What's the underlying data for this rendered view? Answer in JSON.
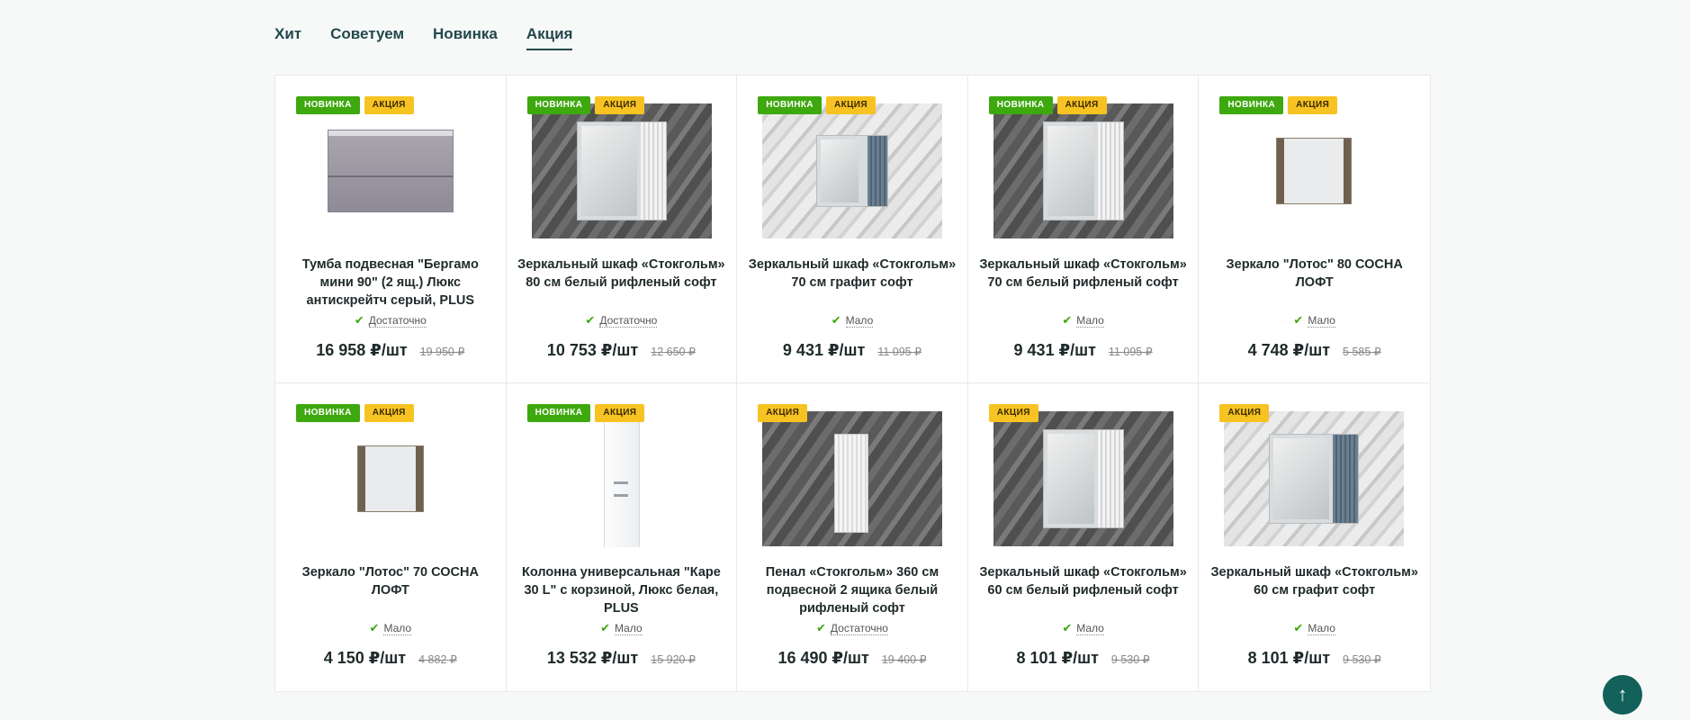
{
  "tabs": [
    {
      "label": "Хит"
    },
    {
      "label": "Советуем"
    },
    {
      "label": "Новинка"
    },
    {
      "label": "Акция"
    }
  ],
  "badge_labels": {
    "new": "НОВИНКА",
    "sale": "АКЦИЯ"
  },
  "products": [
    {
      "name": "Тумба подвесная \"Бергамо мини 90\" (2 ящ.) Люкс антискрейтч серый, PLUS",
      "stock": "Достаточно",
      "price": "16 958 ₽/шт",
      "old_price": "19 950 ₽"
    },
    {
      "name": "Зеркальный шкаф «Стокгольм» 80 см белый рифленый софт",
      "stock": "Достаточно",
      "price": "10 753 ₽/шт",
      "old_price": "12 650 ₽"
    },
    {
      "name": "Зеркальный шкаф «Стокгольм» 70 см графит софт",
      "stock": "Мало",
      "price": "9 431 ₽/шт",
      "old_price": "11 095 ₽"
    },
    {
      "name": "Зеркальный шкаф «Стокгольм» 70 см белый рифленый софт",
      "stock": "Мало",
      "price": "9 431 ₽/шт",
      "old_price": "11 095 ₽"
    },
    {
      "name": "Зеркало \"Лотос\" 80 СОСНА ЛОФТ",
      "stock": "Мало",
      "price": "4 748 ₽/шт",
      "old_price": "5 585 ₽"
    },
    {
      "name": "Зеркало \"Лотос\" 70 СОСНА ЛОФТ",
      "stock": "Мало",
      "price": "4 150 ₽/шт",
      "old_price": "4 882 ₽"
    },
    {
      "name": "Колонна универсальная \"Каре 30 L\" с корзиной, Люкс белая, PLUS",
      "stock": "Мало",
      "price": "13 532 ₽/шт",
      "old_price": "15 920 ₽"
    },
    {
      "name": "Пенал «Стокгольм» 360 см подвесной 2 ящика белый рифленый софт",
      "stock": "Достаточно",
      "price": "16 490 ₽/шт",
      "old_price": "19 400 ₽"
    },
    {
      "name": "Зеркальный шкаф «Стокгольм» 60 см белый рифленый софт",
      "stock": "Мало",
      "price": "8 101 ₽/шт",
      "old_price": "9 530 ₽"
    },
    {
      "name": "Зеркальный шкаф «Стокгольм» 60 см графит софт",
      "stock": "Мало",
      "price": "8 101 ₽/шт",
      "old_price": "9 530 ₽"
    }
  ],
  "icons": {
    "check": "check-icon",
    "scroll_top": "arrow-up-icon"
  },
  "colors": {
    "accent": "#21484a",
    "new_badge": "#3ea80f",
    "sale_badge": "#f7c323",
    "scroll_button": "#12615a"
  }
}
